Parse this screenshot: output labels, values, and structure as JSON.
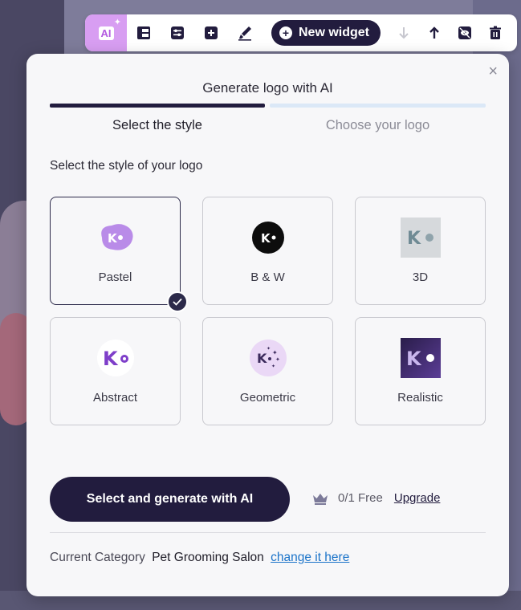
{
  "toolbar": {
    "ai_label": "AI",
    "new_widget_label": "New widget",
    "icons": [
      "layout-icon",
      "settings-sliders-icon",
      "add-section-icon",
      "brush-icon",
      "arrow-down-icon",
      "arrow-up-icon",
      "hide-icon",
      "trash-icon"
    ]
  },
  "modal": {
    "title": "Generate logo with AI",
    "close_label": "×",
    "steps": [
      {
        "label": "Select the style",
        "active": true
      },
      {
        "label": "Choose your logo",
        "active": false
      }
    ],
    "section_label": "Select the style of your logo",
    "styles": [
      {
        "label": "Pastel",
        "selected": true
      },
      {
        "label": "B & W",
        "selected": false
      },
      {
        "label": "3D",
        "selected": false
      },
      {
        "label": "Abstract",
        "selected": false
      },
      {
        "label": "Geometric",
        "selected": false
      },
      {
        "label": "Realistic",
        "selected": false
      }
    ],
    "cta_label": "Select and generate with AI",
    "credits_text": "0/1 Free",
    "upgrade_label": "Upgrade",
    "footer": {
      "prefix": "Current Category",
      "category": "Pet Grooming Salon",
      "change_link": "change it here"
    }
  },
  "colors": {
    "primary": "#221c3e",
    "accent_ai": "#d89ef2",
    "link": "#1a73c9",
    "progress_track": "#dbe8f7"
  }
}
